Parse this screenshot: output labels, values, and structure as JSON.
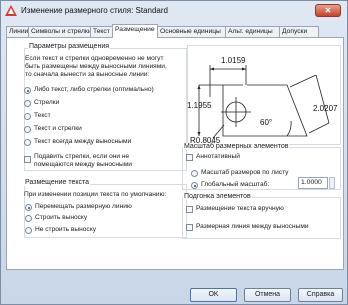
{
  "window": {
    "title": "Изменение размерного стиля: Standard",
    "close_label": "✕"
  },
  "tabs": [
    {
      "label": "Линии"
    },
    {
      "label": "Символы и стрелки"
    },
    {
      "label": "Текст"
    },
    {
      "label": "Размещение"
    },
    {
      "label": "Основные единицы"
    },
    {
      "label": "Альт. единицы"
    },
    {
      "label": "Допуски"
    }
  ],
  "fit": {
    "title": "Параметры размещения",
    "description": [
      "Если текст и стрелки одновременно не могут",
      "быть размещены между выносными линиями,",
      "то сначала вынести за выносные линии:"
    ],
    "options": [
      {
        "label": "Либо текст, либо стрелки (оптимально)",
        "selected": true
      },
      {
        "label": "Стрелки",
        "selected": false
      },
      {
        "label": "Текст",
        "selected": false
      },
      {
        "label": "Текст и стрелки",
        "selected": false
      },
      {
        "label": "Текст всегда между выносными",
        "selected": false
      }
    ],
    "suppress_lines": [
      "Подавить стрелки, если они не",
      "помещаются между выносными"
    ]
  },
  "text_placement": {
    "title": "Размещение текста",
    "subtitle": "При изменении позиции текста по умолчанию:",
    "options": [
      {
        "label": "Перемещать размерную линию",
        "selected": true
      },
      {
        "label": "Строить выноску",
        "selected": false
      },
      {
        "label": "Не строить выноску",
        "selected": false
      }
    ]
  },
  "preview": {
    "dim_top": "1.0159",
    "dim_left": "1.1955",
    "dim_right": "2.0207",
    "angle": "60°",
    "radius": "R0.8045"
  },
  "scale": {
    "title": "Масштаб размерных элементов",
    "annotative": "Аннотативный",
    "to_layout": "Масштаб размеров по листу",
    "global": "Глобальный масштаб:",
    "global_value": "1.0000"
  },
  "fine_tuning": {
    "title": "Подгонка элементов",
    "manual": "Размещение текста вручную",
    "draw_line": "Размерная линия между выносными"
  },
  "buttons": {
    "ok": "OK",
    "cancel": "Отмена",
    "help": "Справка"
  }
}
